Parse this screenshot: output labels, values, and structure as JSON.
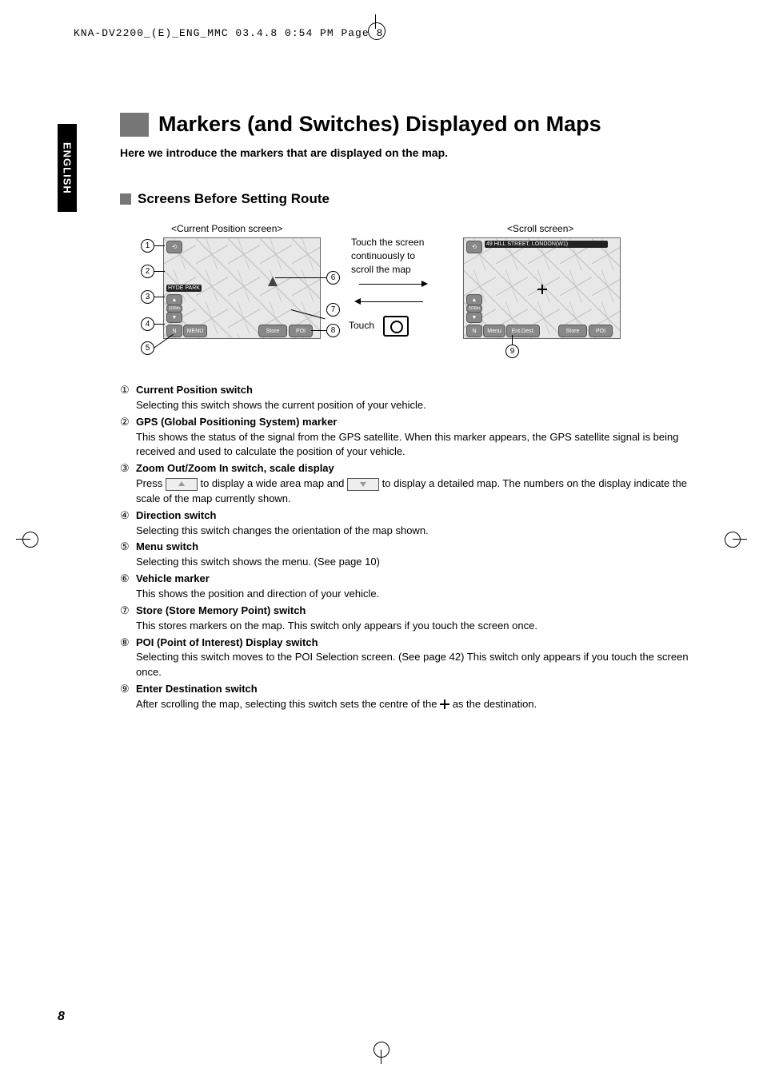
{
  "header": "KNA-DV2200_(E)_ENG_MMC  03.4.8  0:54 PM  Page 8",
  "sidebar_label": "ENGLISH",
  "title": "Markers (and Switches) Displayed on Maps",
  "intro": "Here we introduce the markers that are displayed on the map.",
  "subsection": "Screens Before Setting Route",
  "figure": {
    "left_label": "<Current Position screen>",
    "right_label": "<Scroll screen>",
    "scroll_hint": "Touch the screen continuously to scroll the map",
    "touch_label": "Touch",
    "address_banner": "49 HILL STREET, LONDON(W1)",
    "left_buttons": {
      "store": "Store",
      "poi": "POI",
      "menu": "MENU"
    },
    "right_buttons": {
      "menu": "Menu",
      "entdest": "Ent.Dest.",
      "store": "Store",
      "poi": "POI"
    },
    "park_label": "HYDE PARK",
    "scale": "1/16m"
  },
  "definitions": [
    {
      "num": "①",
      "title": "Current Position switch",
      "body": "Selecting this switch shows the current position of your vehicle."
    },
    {
      "num": "②",
      "title": "GPS (Global Positioning System) marker",
      "body": "This shows the status of the signal from the GPS satellite. When this marker appears, the GPS satellite signal is being received and used to calculate the position of your vehicle."
    },
    {
      "num": "③",
      "title": "Zoom Out/Zoom In switch, scale display",
      "body_pre": "Press ",
      "body_mid": " to display a wide area map and ",
      "body_post": " to display a detailed map. The numbers on the display indicate the scale of the map currently shown."
    },
    {
      "num": "④",
      "title": "Direction switch",
      "body": "Selecting this switch changes the orientation of the map shown."
    },
    {
      "num": "⑤",
      "title": "Menu switch",
      "body": "Selecting this switch shows the menu. (See page 10)"
    },
    {
      "num": "⑥",
      "title": "Vehicle marker",
      "body": "This shows the position and direction of your vehicle."
    },
    {
      "num": "⑦",
      "title": "Store (Store Memory Point) switch",
      "body": "This stores markers on the map. This switch only appears if you touch the screen once."
    },
    {
      "num": "⑧",
      "title": "POI (Point of Interest) Display switch",
      "body": "Selecting this switch moves to the POI Selection screen. (See page 42)  This switch only appears if you touch the screen once."
    },
    {
      "num": "⑨",
      "title": "Enter Destination switch",
      "body_pre": "After scrolling the map, selecting this switch sets the centre of the ",
      "body_post": " as the destination."
    }
  ],
  "page_number": "8"
}
